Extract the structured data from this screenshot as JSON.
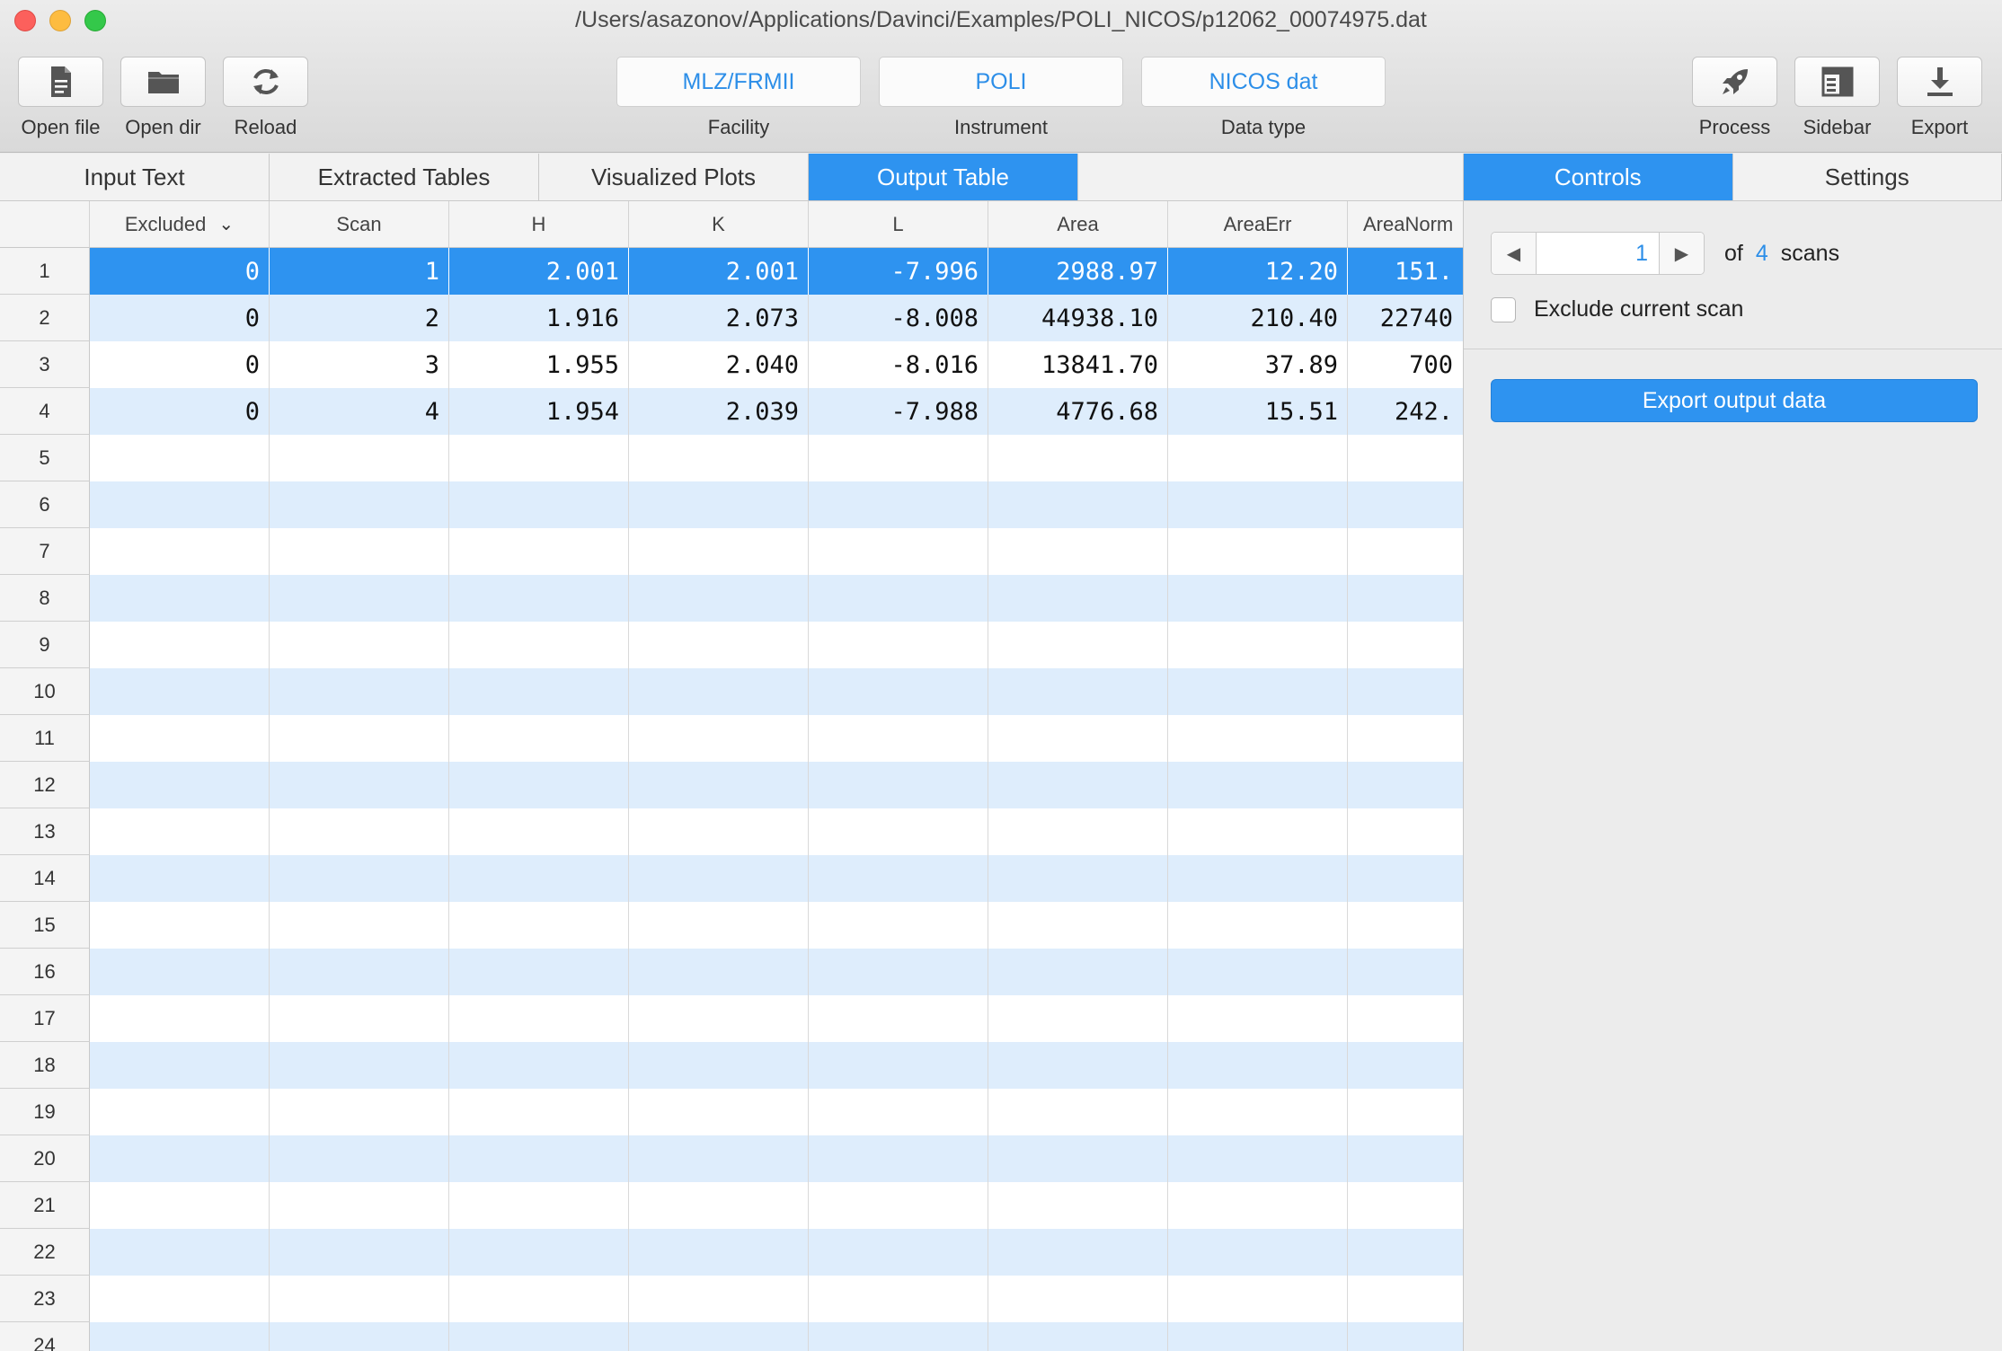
{
  "window": {
    "title": "/Users/asazonov/Applications/Davinci/Examples/POLI_NICOS/p12062_00074975.dat"
  },
  "toolbar": {
    "left_buttons": [
      {
        "label": "Open file",
        "icon": "document-icon"
      },
      {
        "label": "Open dir",
        "icon": "folder-icon"
      },
      {
        "label": "Reload",
        "icon": "reload-icon"
      }
    ],
    "selectors": [
      {
        "value": "MLZ/FRMII",
        "label": "Facility"
      },
      {
        "value": "POLI",
        "label": "Instrument"
      },
      {
        "value": "NICOS dat",
        "label": "Data type"
      }
    ],
    "right_buttons": [
      {
        "label": "Process",
        "icon": "rocket-icon"
      },
      {
        "label": "Sidebar",
        "icon": "sidebar-icon"
      },
      {
        "label": "Export",
        "icon": "download-icon"
      }
    ]
  },
  "tabs": [
    {
      "label": "Input Text",
      "active": false
    },
    {
      "label": "Extracted Tables",
      "active": false
    },
    {
      "label": "Visualized Plots",
      "active": false
    },
    {
      "label": "Output Table",
      "active": true
    }
  ],
  "side_tabs": [
    {
      "label": "Controls",
      "active": true
    },
    {
      "label": "Settings",
      "active": false
    }
  ],
  "table": {
    "columns": [
      "Excluded",
      "Scan",
      "H",
      "K",
      "L",
      "Area",
      "AreaErr",
      "AreaNorm"
    ],
    "rows": [
      [
        "0",
        "1",
        "2.001",
        "2.001",
        "-7.996",
        "2988.97",
        "12.20",
        "151."
      ],
      [
        "0",
        "2",
        "1.916",
        "2.073",
        "-8.008",
        "44938.10",
        "210.40",
        "22740"
      ],
      [
        "0",
        "3",
        "1.955",
        "2.040",
        "-8.016",
        "13841.70",
        "37.89",
        "700"
      ],
      [
        "0",
        "4",
        "1.954",
        "2.039",
        "-7.988",
        "4776.68",
        "15.51",
        "242."
      ]
    ],
    "row_numbers": [
      "1",
      "2",
      "3",
      "4",
      "5",
      "6",
      "7",
      "8",
      "9",
      "10",
      "11",
      "12",
      "13",
      "14",
      "15",
      "16",
      "17",
      "18",
      "19",
      "20",
      "21",
      "22",
      "23",
      "24"
    ],
    "selected_row": 1
  },
  "controls": {
    "current_scan": "1",
    "of_label": "of",
    "scan_count": "4",
    "scans_label": "scans",
    "exclude_label": "Exclude current scan",
    "exclude_checked": false,
    "export_button": "Export output data"
  },
  "colors": {
    "accent": "#2e93f0",
    "link": "#2c8ee8",
    "stripe": "#deedfc"
  }
}
